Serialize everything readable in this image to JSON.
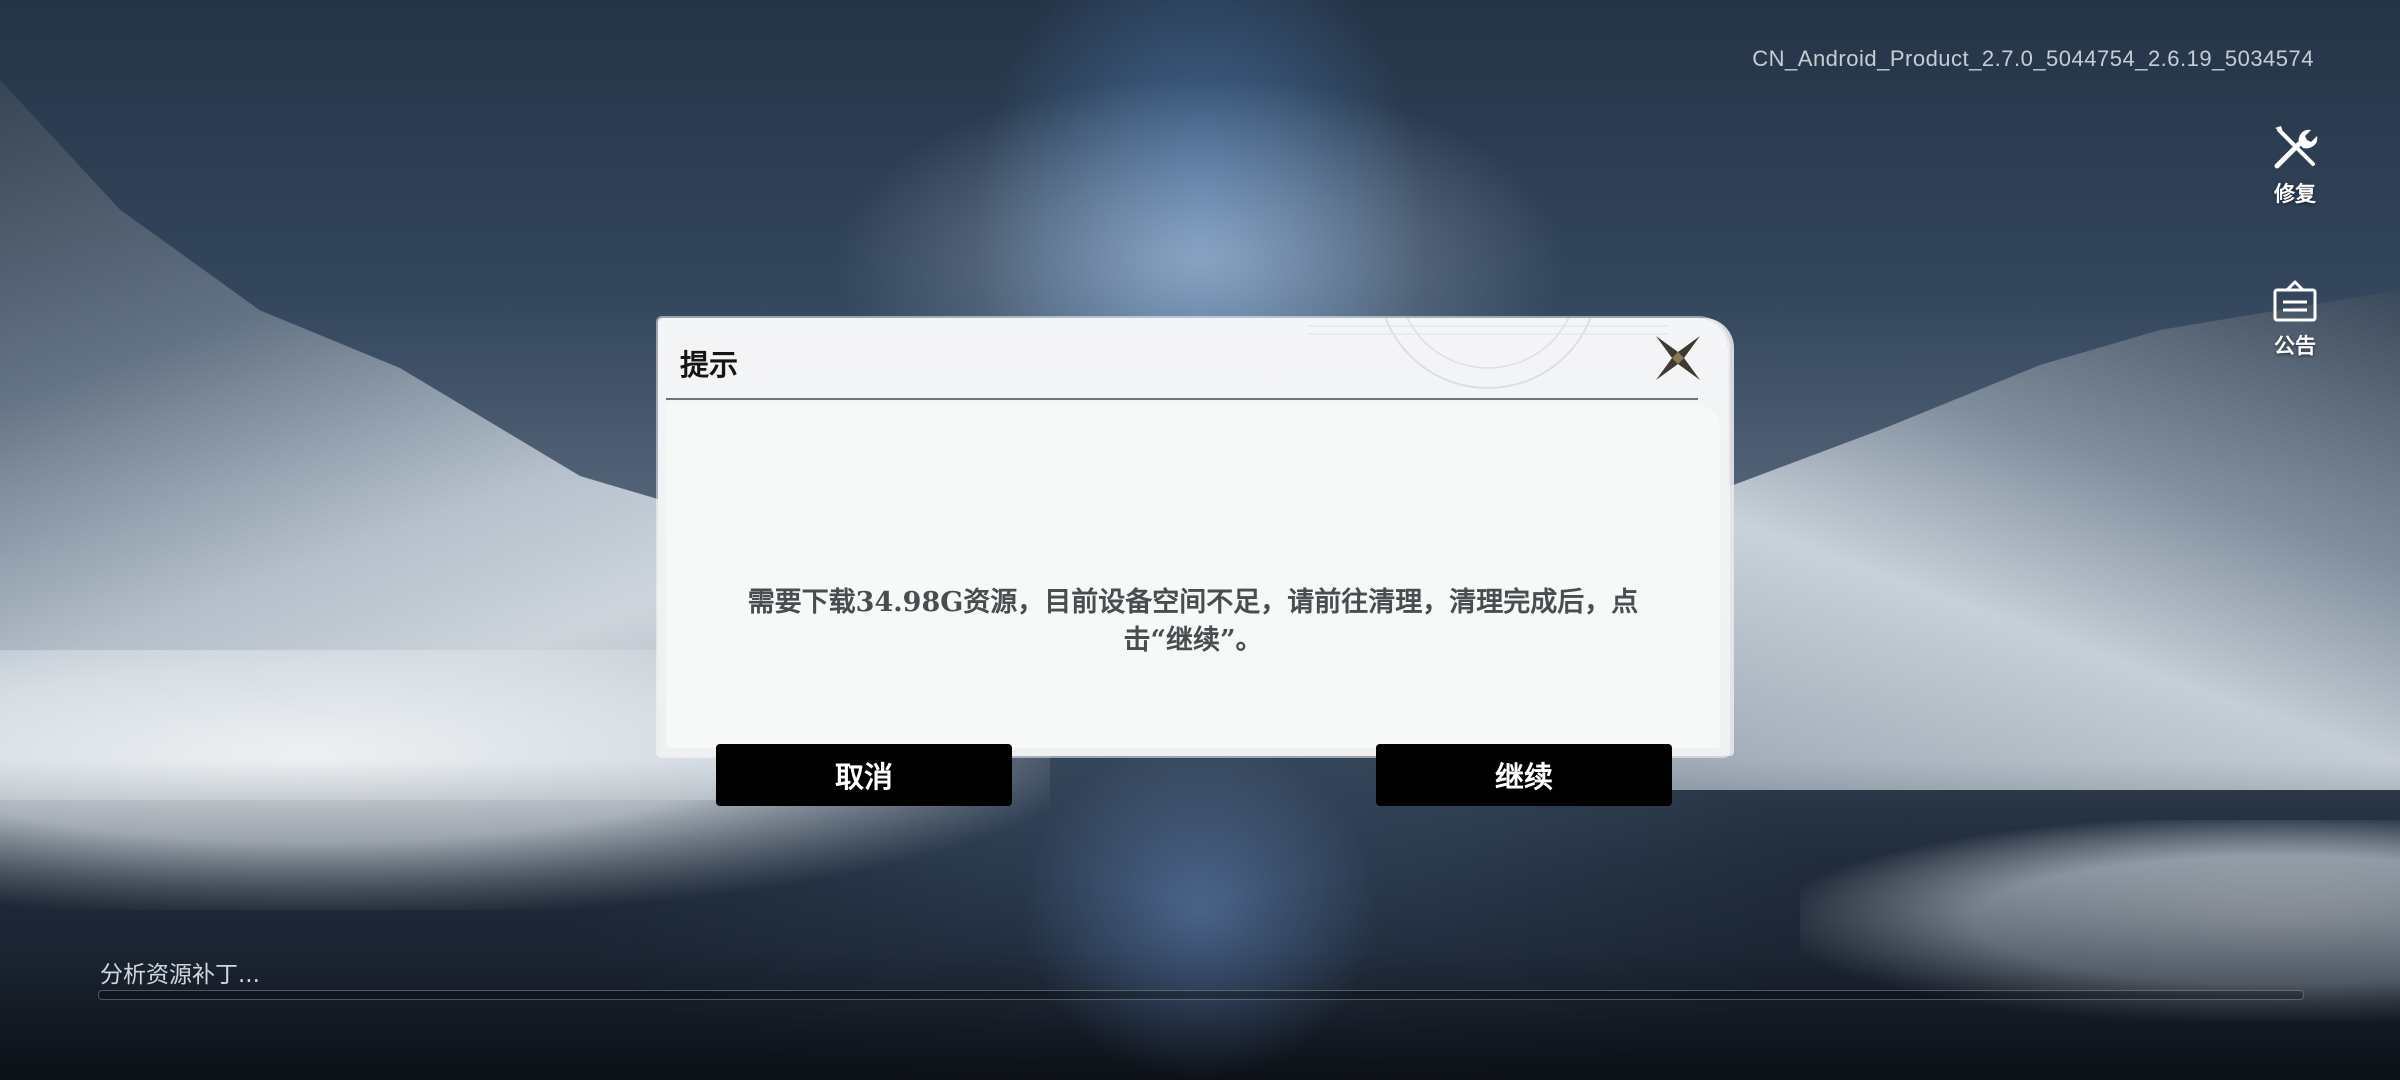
{
  "version": "CN_Android_Product_2.7.0_5044754_2.6.19_5034574",
  "side_buttons": {
    "repair_label": "修复",
    "notice_label": "公告"
  },
  "dialog": {
    "title": "提示",
    "message": "需要下载34.98G资源，目前设备空间不足，请前往清理，清理完成后，点击“继续”。",
    "cancel_label": "取消",
    "continue_label": "继续"
  },
  "progress": {
    "label": "分析资源补丁...",
    "fraction": 0
  }
}
